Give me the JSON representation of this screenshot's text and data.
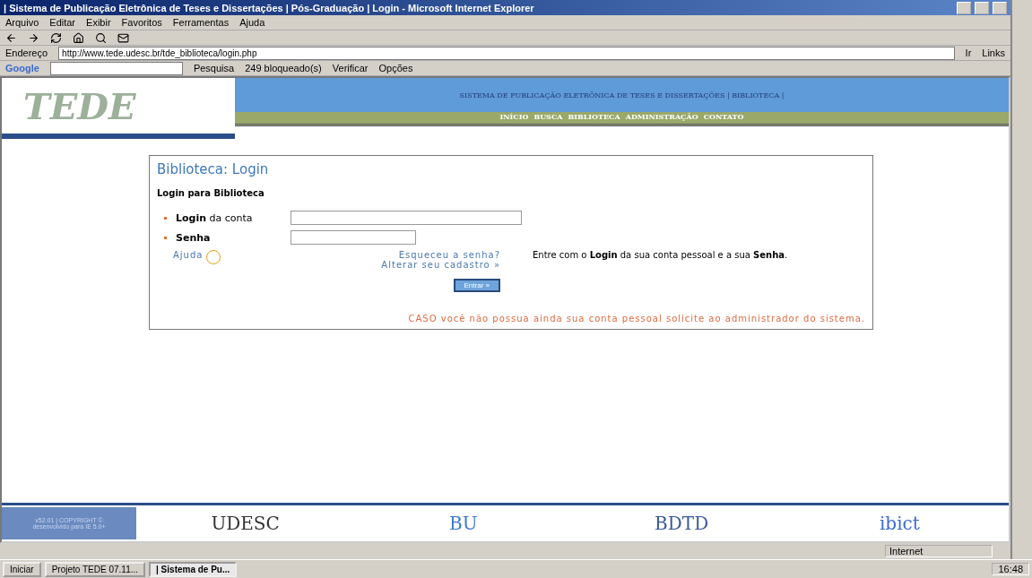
{
  "window": {
    "title": "| Sistema de Publicação Eletrônica de Teses e Dissertações | Pós-Graduação | Login - Microsoft Internet Explorer"
  },
  "menu": [
    "Arquivo",
    "Editar",
    "Exibir",
    "Favoritos",
    "Ferramentas",
    "Ajuda"
  ],
  "address": {
    "label": "Endereço",
    "value": "http://www.tede.udesc.br/tde_biblioteca/login.php",
    "go": "Ir",
    "links": "Links"
  },
  "google_bar": {
    "logo": "Google",
    "search": "Pesquisa",
    "blocked": "249 bloqueado(s)",
    "check": "Verificar",
    "options": "Opções"
  },
  "site": {
    "logo": "TEDE",
    "title": "SISTEMA DE PUBLICAÇÃO ELETRÔNICA DE TESES E DISSERTAÇÕES | BIBLIOTECA |",
    "nav": [
      "INÍCIO",
      "BUSCA",
      "BIBLIOTECA",
      "ADMINISTRAÇÃO",
      "CONTATO"
    ]
  },
  "login": {
    "heading": "Biblioteca: Login",
    "subheading": "Login para Biblioteca",
    "fields": [
      {
        "label": "**Login** da conta",
        "kind": "wide"
      },
      {
        "label": "**Senha**",
        "kind": "narrow"
      }
    ],
    "help": "Ajuda",
    "forgot": "Esqueceu a senha?",
    "change": "Alterar seu cadastro »",
    "submit": "Entrar »",
    "info": "Entre com o **Login** da sua conta pessoal e a sua **Senha**.",
    "notice": "CASO você não possua ainda sua conta pessoal solicite ao administrador do sistema."
  },
  "footer": {
    "copyright": [
      "v52.01 | COPYRIGHT ©",
      "desenvolvido para IE 5.0+"
    ],
    "logos": [
      "UDESC",
      "BU",
      "BDTD",
      "ibict"
    ]
  },
  "status_bar": {
    "zone": "Internet"
  },
  "taskbar": {
    "start": "Iniciar",
    "tasks": [
      {
        "label": "Projeto TEDE 07.11...",
        "selected": false
      },
      {
        "label": "| Sistema de Pu...",
        "selected": true
      }
    ],
    "clock": "16:48"
  }
}
